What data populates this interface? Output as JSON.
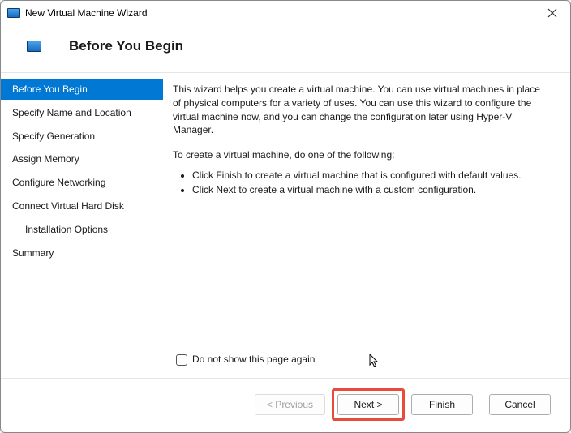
{
  "window": {
    "title": "New Virtual Machine Wizard"
  },
  "header": {
    "title": "Before You Begin"
  },
  "sidebar": {
    "items": [
      {
        "label": "Before You Begin",
        "selected": true,
        "indent": false
      },
      {
        "label": "Specify Name and Location",
        "selected": false,
        "indent": false
      },
      {
        "label": "Specify Generation",
        "selected": false,
        "indent": false
      },
      {
        "label": "Assign Memory",
        "selected": false,
        "indent": false
      },
      {
        "label": "Configure Networking",
        "selected": false,
        "indent": false
      },
      {
        "label": "Connect Virtual Hard Disk",
        "selected": false,
        "indent": false
      },
      {
        "label": "Installation Options",
        "selected": false,
        "indent": true
      },
      {
        "label": "Summary",
        "selected": false,
        "indent": false
      }
    ]
  },
  "content": {
    "intro": "This wizard helps you create a virtual machine. You can use virtual machines in place of physical computers for a variety of uses. You can use this wizard to configure the virtual machine now, and you can change the configuration later using Hyper-V Manager.",
    "instruction": "To create a virtual machine, do one of the following:",
    "bullets": [
      "Click Finish to create a virtual machine that is configured with default values.",
      "Click Next to create a virtual machine with a custom configuration."
    ],
    "checkbox_label": "Do not show this page again"
  },
  "footer": {
    "previous": "< Previous",
    "next": "Next >",
    "finish": "Finish",
    "cancel": "Cancel"
  }
}
